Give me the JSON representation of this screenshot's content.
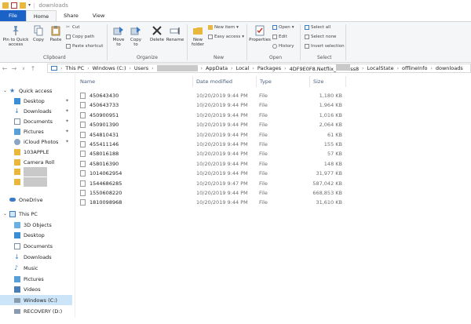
{
  "window": {
    "title": "downloads"
  },
  "tabs": [
    "File",
    "Home",
    "Share",
    "View"
  ],
  "ribbon": {
    "clipboard": {
      "pin_label": "Pin to Quick access",
      "copy_label": "Copy",
      "paste_label": "Paste",
      "cut_label": "Cut",
      "copy_path_label": "Copy path",
      "paste_shortcut_label": "Paste shortcut",
      "group_label": "Clipboard"
    },
    "organize": {
      "move_to_label": "Move to",
      "copy_to_label": "Copy to",
      "delete_label": "Delete",
      "rename_label": "Rename",
      "group_label": "Organize"
    },
    "new": {
      "new_folder_label": "New folder",
      "new_item_label": "New item",
      "easy_access_label": "Easy access",
      "group_label": "New"
    },
    "open": {
      "properties_label": "Properties",
      "open_label": "Open",
      "edit_label": "Edit",
      "history_label": "History",
      "group_label": "Open"
    },
    "select": {
      "select_all_label": "Select all",
      "select_none_label": "Select none",
      "invert_selection_label": "Invert selection",
      "group_label": "Select"
    }
  },
  "address": {
    "crumbs": [
      "This PC",
      "Windows (C:)",
      "Users",
      "AppData",
      "Local",
      "Packages",
      "4DF9E0F8.Netflix_",
      "ss8",
      "LocalState",
      "offlineInfo",
      "downloads"
    ]
  },
  "sidebar": {
    "quick_access": "Quick access",
    "items": [
      "Desktop",
      "Downloads",
      "Documents",
      "Pictures",
      "iCloud Photos",
      "103APPLE",
      "Camera Roll"
    ],
    "onedrive": "OneDrive",
    "this_pc": "This PC",
    "pc_items": [
      "3D Objects",
      "Desktop",
      "Documents",
      "Downloads",
      "Music",
      "Pictures",
      "Videos",
      "Windows (C:)",
      "RECOVERY (D:)"
    ]
  },
  "columns": {
    "name": "Name",
    "date": "Date modified",
    "type": "Type",
    "size": "Size"
  },
  "files": [
    {
      "name": "450643430",
      "date": "10/20/2019 9:44 PM",
      "type": "File",
      "size": "1,180 KB"
    },
    {
      "name": "450643733",
      "date": "10/20/2019 9:44 PM",
      "type": "File",
      "size": "1,964 KB"
    },
    {
      "name": "450900951",
      "date": "10/20/2019 9:44 PM",
      "type": "File",
      "size": "1,016 KB"
    },
    {
      "name": "450901390",
      "date": "10/20/2019 9:44 PM",
      "type": "File",
      "size": "2,064 KB"
    },
    {
      "name": "454810431",
      "date": "10/20/2019 9:44 PM",
      "type": "File",
      "size": "61 KB"
    },
    {
      "name": "455411146",
      "date": "10/20/2019 9:44 PM",
      "type": "File",
      "size": "155 KB"
    },
    {
      "name": "458016188",
      "date": "10/20/2019 9:44 PM",
      "type": "File",
      "size": "57 KB"
    },
    {
      "name": "458016390",
      "date": "10/20/2019 9:44 PM",
      "type": "File",
      "size": "148 KB"
    },
    {
      "name": "1014062954",
      "date": "10/20/2019 9:44 PM",
      "type": "File",
      "size": "31,977 KB"
    },
    {
      "name": "1544686285",
      "date": "10/20/2019 9:47 PM",
      "type": "File",
      "size": "587,042 KB"
    },
    {
      "name": "1550608220",
      "date": "10/20/2019 9:44 PM",
      "type": "File",
      "size": "668,853 KB"
    },
    {
      "name": "1810098968",
      "date": "10/20/2019 9:44 PM",
      "type": "File",
      "size": "31,610 KB"
    }
  ]
}
